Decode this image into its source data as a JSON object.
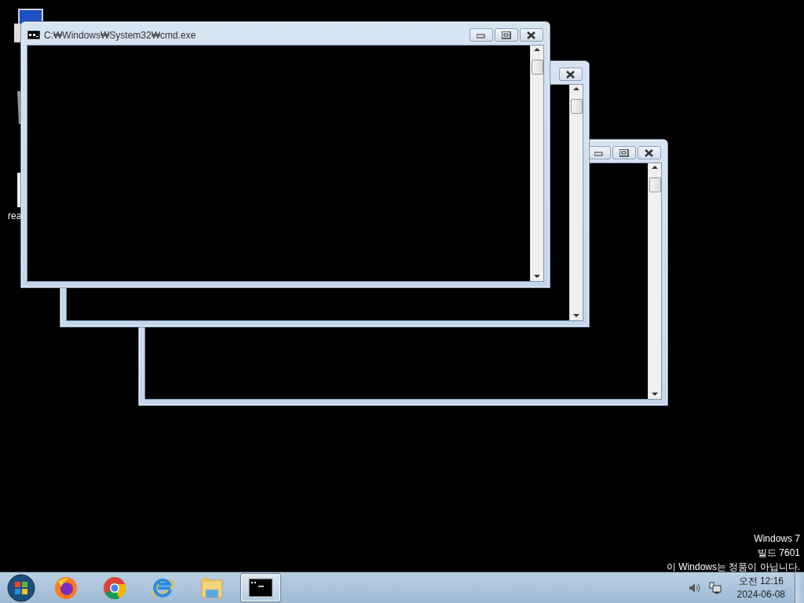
{
  "desktop_icon_label": "rea",
  "cmd_window": {
    "title": "C:₩Windows₩System32₩cmd.exe"
  },
  "activation_notice": [
    "Windows 7",
    "빌드 7601",
    "이 Windows는 정품이 아닙니다."
  ],
  "taskbar": {
    "buttons": [
      {
        "kind": "firefox",
        "selected": false
      },
      {
        "kind": "chrome",
        "selected": false
      },
      {
        "kind": "ie",
        "selected": false
      },
      {
        "kind": "explorer",
        "selected": false
      },
      {
        "kind": "cmd",
        "selected": true
      }
    ],
    "clock": {
      "time": "오전 12:16",
      "date": "2024-06-08"
    }
  }
}
